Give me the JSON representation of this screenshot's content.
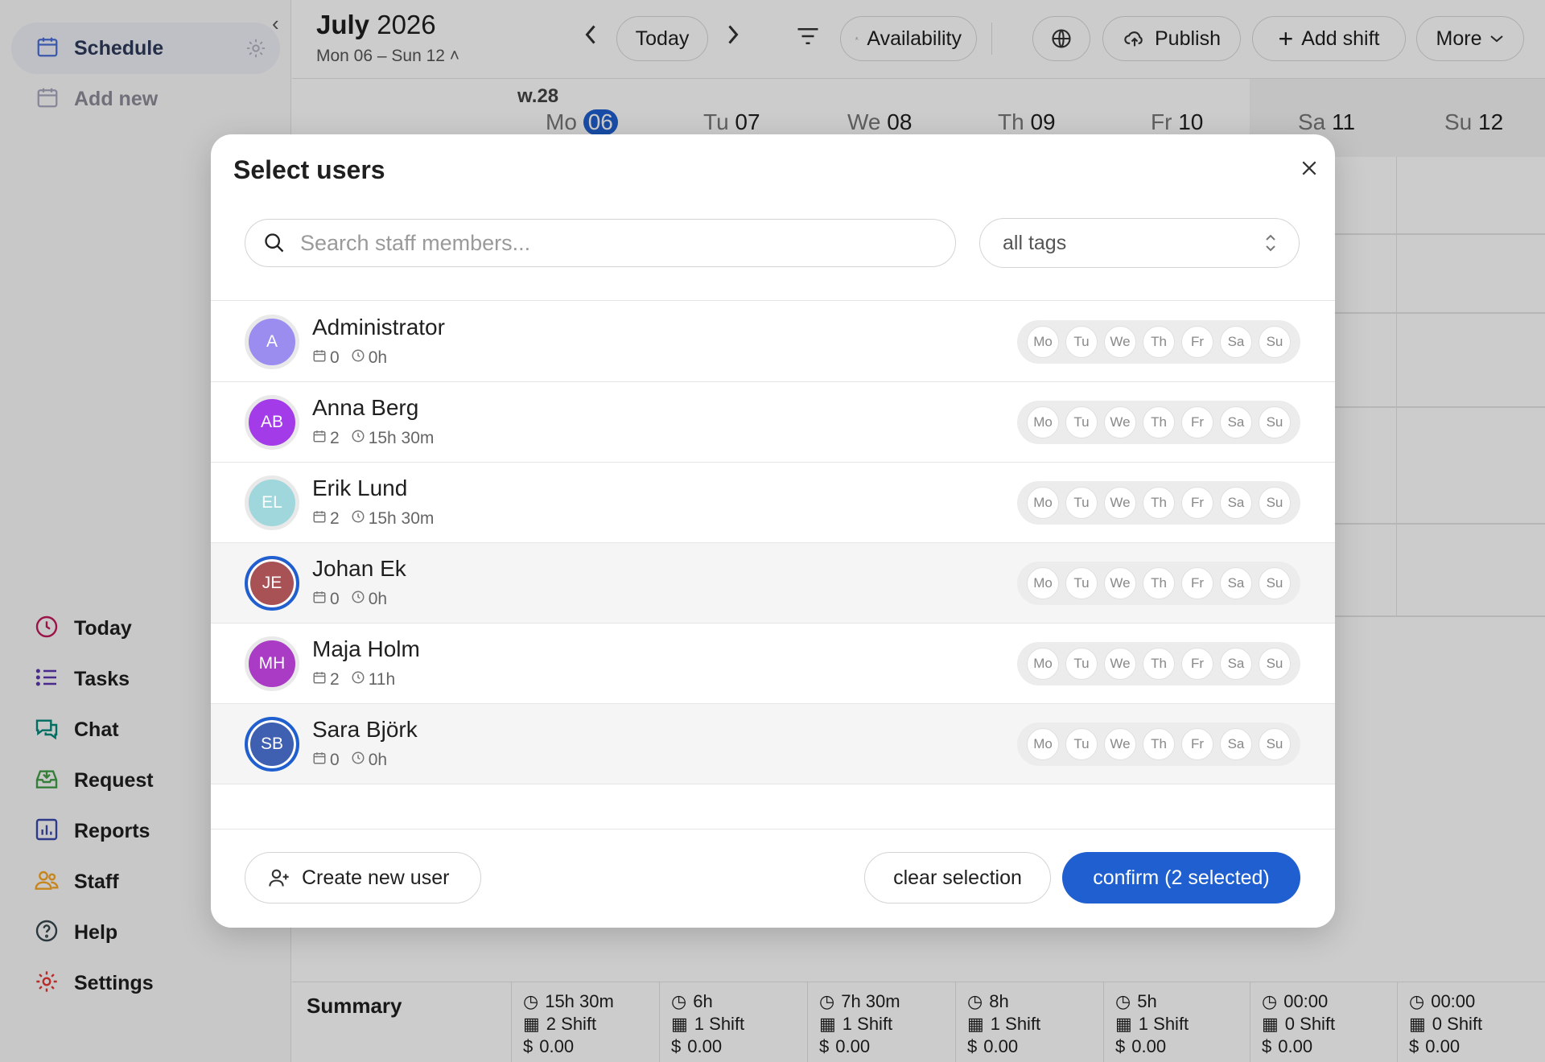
{
  "sidebar": {
    "schedule_label": "Schedule",
    "add_new_label": "Add new",
    "nav": [
      {
        "label": "Today",
        "icon": "clock-icon",
        "color": "#c2185b"
      },
      {
        "label": "Tasks",
        "icon": "list-icon",
        "color": "#5e35b1"
      },
      {
        "label": "Chat",
        "icon": "chat-icon",
        "color": "#00897b"
      },
      {
        "label": "Request",
        "icon": "inbox-icon",
        "color": "#43a047"
      },
      {
        "label": "Reports",
        "icon": "bar-chart-icon",
        "color": "#3949ab"
      },
      {
        "label": "Staff",
        "icon": "people-icon",
        "color": "#f9a825"
      },
      {
        "label": "Help",
        "icon": "help-icon",
        "color": "#37474f"
      },
      {
        "label": "Settings",
        "icon": "gear-icon",
        "color": "#e53935"
      }
    ]
  },
  "header": {
    "month": "July",
    "year": "2026",
    "range": "Mon 06 – Sun 12",
    "today_label": "Today",
    "availability_label": "Availability",
    "publish_label": "Publish",
    "add_shift_label": "Add shift",
    "more_label": "More"
  },
  "calendar": {
    "week_label": "w.28",
    "days": [
      {
        "abbr": "Mo",
        "num": "06",
        "today": true
      },
      {
        "abbr": "Tu",
        "num": "07"
      },
      {
        "abbr": "We",
        "num": "08"
      },
      {
        "abbr": "Th",
        "num": "09"
      },
      {
        "abbr": "Fr",
        "num": "10"
      },
      {
        "abbr": "Sa",
        "num": "11"
      },
      {
        "abbr": "Su",
        "num": "12"
      }
    ]
  },
  "summary": {
    "title": "Summary",
    "cols": [
      {
        "hours": "15h 30m",
        "shifts": "2 Shift",
        "cost": "0.00"
      },
      {
        "hours": "6h",
        "shifts": "1 Shift",
        "cost": "0.00"
      },
      {
        "hours": "7h 30m",
        "shifts": "1 Shift",
        "cost": "0.00"
      },
      {
        "hours": "8h",
        "shifts": "1 Shift",
        "cost": "0.00"
      },
      {
        "hours": "5h",
        "shifts": "1 Shift",
        "cost": "0.00"
      },
      {
        "hours": "00:00",
        "shifts": "0 Shift",
        "cost": "0.00"
      },
      {
        "hours": "00:00",
        "shifts": "0 Shift",
        "cost": "0.00"
      }
    ]
  },
  "modal": {
    "title": "Select users",
    "search_placeholder": "Search staff members...",
    "tags_value": "all tags",
    "weekdays": [
      "Mo",
      "Tu",
      "We",
      "Th",
      "Fr",
      "Sa",
      "Su"
    ],
    "users": [
      {
        "initials": "A",
        "name": "Administrator",
        "shifts": "0",
        "hours": "0h",
        "color": "#9b8cf0",
        "selected": false
      },
      {
        "initials": "AB",
        "name": "Anna Berg",
        "shifts": "2",
        "hours": "15h 30m",
        "color": "#a33be8",
        "selected": false
      },
      {
        "initials": "EL",
        "name": "Erik Lund",
        "shifts": "2",
        "hours": "15h 30m",
        "color": "#9fd7dc",
        "selected": false
      },
      {
        "initials": "JE",
        "name": "Johan Ek",
        "shifts": "0",
        "hours": "0h",
        "color": "#a95256",
        "selected": true
      },
      {
        "initials": "MH",
        "name": "Maja Holm",
        "shifts": "2",
        "hours": "11h",
        "color": "#a93bc4",
        "selected": false
      },
      {
        "initials": "SB",
        "name": "Sara Björk",
        "shifts": "0",
        "hours": "0h",
        "color": "#3f5fb0",
        "selected": true
      }
    ],
    "create_label": "Create new user",
    "clear_label": "clear selection",
    "confirm_label": "confirm (2 selected)"
  },
  "colors": {
    "accent": "#1f5fd0"
  }
}
